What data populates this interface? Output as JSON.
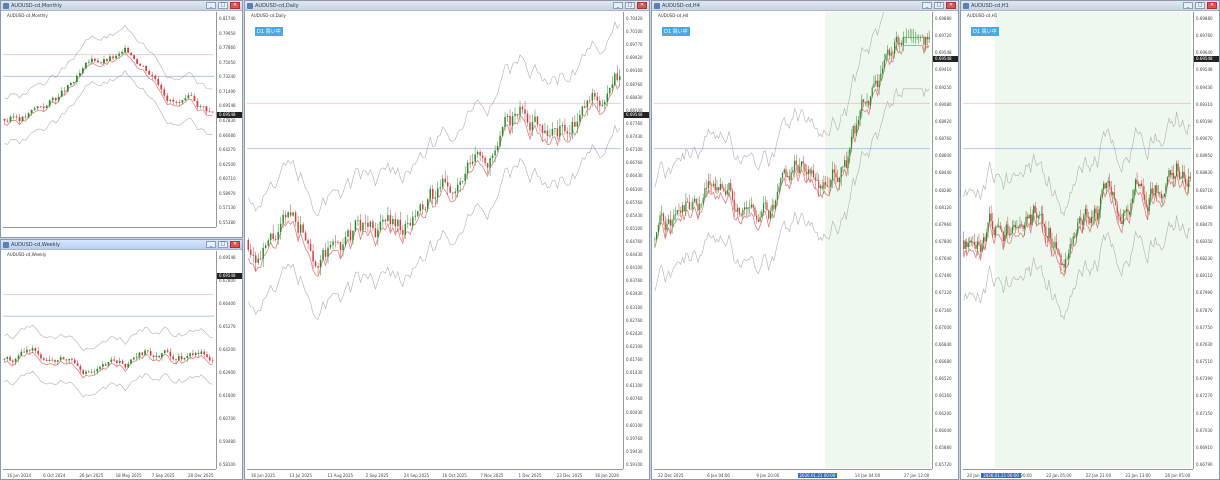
{
  "colors": {
    "bull": "#2f8a2f",
    "bear": "#d04040",
    "ma": "#e08080",
    "band": "#b0b0b0",
    "hline_blue": "#7090d0",
    "hline_red": "#e0a0a0",
    "shade": "#eef8ee"
  },
  "windows": [
    {
      "id": "monthly",
      "title": "AUDUSD-cd,Monthly",
      "symbol": "AUDUSD-cd,Monthly",
      "price": "0.69548",
      "ticks": [
        "0.81740",
        "0.79950",
        "0.77860",
        "0.75050",
        "0.73240",
        "0.71490",
        "0.69548",
        "0.67830",
        "0.66080",
        "0.64270",
        "0.62500",
        "0.60710",
        "0.58970",
        "0.57130",
        "0.55380"
      ],
      "xticks": [],
      "tag": "",
      "seed": 3,
      "n": 70
    },
    {
      "id": "weekly",
      "title": "AUDUSD-cd,Weekly",
      "symbol": "AUDUSD-cd,Weekly",
      "price": "0.69548",
      "ticks": [
        "0.69548",
        "0.67800",
        "0.66400",
        "0.65270",
        "0.64200",
        "0.62900",
        "0.61800",
        "0.60700",
        "0.59480",
        "0.58100"
      ],
      "xticks": [
        "16 Jun 2024",
        "6 Oct 2024",
        "26 Jan 2025",
        "18 May 2025",
        "7 Sep 2025",
        "28 Dec 2025"
      ],
      "tag": "",
      "seed": 9,
      "n": 75
    },
    {
      "id": "daily",
      "title": "AUDUSD-cd,Daily",
      "symbol": "AUDUSD-cd,Daily",
      "price": "0.69548",
      "tag": "D1 買い中",
      "ticks": [
        "0.70420",
        "0.70100",
        "0.69770",
        "0.69420",
        "0.69100",
        "0.68760",
        "0.68430",
        "0.68100",
        "0.67760",
        "0.67430",
        "0.67100",
        "0.66760",
        "0.66430",
        "0.66100",
        "0.65760",
        "0.65430",
        "0.65100",
        "0.64760",
        "0.64430",
        "0.64100",
        "0.63760",
        "0.63430",
        "0.63100",
        "0.62760",
        "0.62430",
        "0.62100",
        "0.61760",
        "0.61430",
        "0.61100",
        "0.60760",
        "0.60430",
        "0.60100",
        "0.59760",
        "0.59430",
        "0.59100"
      ],
      "xticks": [
        "16 Jun 2025",
        "13 Jul 2025",
        "11 Aug 2025",
        "2 Sep 2025",
        "24 Sep 2025",
        "16 Oct 2025",
        "7 Nov 2025",
        "1 Dec 2025",
        "23 Dec 2025",
        "16 Jan 2026"
      ],
      "seed": 21,
      "n": 150
    },
    {
      "id": "h4",
      "title": "AUDUSD-cd,H4",
      "symbol": "AUDUSD-cd,H4",
      "price": "0.69548",
      "tag": "D1 買い中",
      "ticks": [
        "0.69880",
        "0.69720",
        "0.69548",
        "0.69410",
        "0.69250",
        "0.69080",
        "0.68920",
        "0.68760",
        "0.68600",
        "0.68440",
        "0.68280",
        "0.68120",
        "0.67960",
        "0.67800",
        "0.67640",
        "0.67480",
        "0.67320",
        "0.67160",
        "0.67000",
        "0.66840",
        "0.66680",
        "0.66520",
        "0.66360",
        "0.66200",
        "0.66040",
        "0.65880",
        "0.65720"
      ],
      "xticks": [
        "22 Dec 2025",
        "6 Jan 04:00",
        "9 Jan 20:00",
        "13 Jan 12:00",
        "14 Jan 04:00",
        "27 Jan 12:00"
      ],
      "highlight": "2026.01.21 00:00",
      "seed": 33,
      "n": 160
    },
    {
      "id": "h1",
      "title": "AUDUSD-cd,H1",
      "symbol": "AUDUSD-cd,H1",
      "price": "0.69548",
      "tag": "D1 買い中",
      "ticks": [
        "0.69880",
        "0.69760",
        "0.69640",
        "0.69548",
        "0.69430",
        "0.69310",
        "0.69190",
        "0.69070",
        "0.68950",
        "0.68830",
        "0.68710",
        "0.68590",
        "0.68470",
        "0.68350",
        "0.68230",
        "0.68110",
        "0.67990",
        "0.67870",
        "0.67750",
        "0.67630",
        "0.67510",
        "0.67390",
        "0.67270",
        "0.67150",
        "0.67030",
        "0.66910",
        "0.66790"
      ],
      "xticks": [
        "20 Jan 2026",
        "21 Jan 20:00",
        "22 Jan 05:00",
        "22 Jan 21:00",
        "23 Jan 13:00",
        "26 Jan 05:00"
      ],
      "highlight": "2026.01.21 00:00",
      "seed": 47,
      "n": 150
    }
  ],
  "controls": {
    "min": "_",
    "max": "□",
    "close": "✕"
  }
}
